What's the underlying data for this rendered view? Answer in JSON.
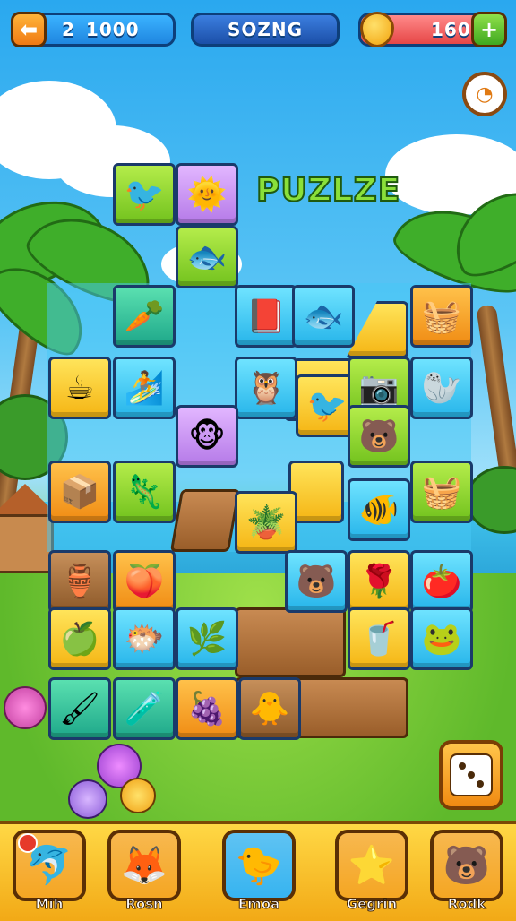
{
  "top_bar": {
    "left_counter": {
      "label": "2",
      "value": "1000"
    },
    "center_title": "SOZNG",
    "right_counter": {
      "value": "160"
    }
  },
  "game_title": "PUZLZE",
  "tiles": [
    {
      "icon": "purple-bird-icon",
      "glyph": "🐦",
      "color": "green"
    },
    {
      "icon": "sun-face-icon",
      "glyph": "🌞",
      "color": "purple"
    },
    {
      "icon": "fish-icon",
      "glyph": "🐟",
      "color": "green"
    },
    {
      "icon": "carrot-icon",
      "glyph": "🥕",
      "color": "teal"
    },
    {
      "icon": "red-book-icon",
      "glyph": "📕",
      "color": "blue"
    },
    {
      "icon": "blue-fish-icon",
      "glyph": "🐟",
      "color": "blue"
    },
    {
      "icon": "basket-icon",
      "glyph": "🧺",
      "color": "orange"
    },
    {
      "icon": "cup-icon",
      "glyph": "☕",
      "color": "yellow"
    },
    {
      "icon": "surfboard-icon",
      "glyph": "🏄",
      "color": "blue"
    },
    {
      "icon": "owl-icon",
      "glyph": "🦉",
      "color": "blue"
    },
    {
      "icon": "blue-bird-icon",
      "glyph": "🐦",
      "color": "yellow"
    },
    {
      "icon": "camera-icon",
      "glyph": "📷",
      "color": "green"
    },
    {
      "icon": "seal-icon",
      "glyph": "🦭",
      "color": "blue"
    },
    {
      "icon": "monkey-icon",
      "glyph": "🐵",
      "color": "purple"
    },
    {
      "icon": "bear-face-icon",
      "glyph": "🐻",
      "color": "green"
    },
    {
      "icon": "purple-box-icon",
      "glyph": "📦",
      "color": "orange"
    },
    {
      "icon": "lizard-icon",
      "glyph": "🦎",
      "color": "green"
    },
    {
      "icon": "plant-pot-icon",
      "glyph": "🪴",
      "color": "yellow"
    },
    {
      "icon": "red-fish-icon",
      "glyph": "🐠",
      "color": "blue"
    },
    {
      "icon": "vegetable-basket-icon",
      "glyph": "🧺",
      "color": "green"
    },
    {
      "icon": "vase-icon",
      "glyph": "🏺",
      "color": "brown"
    },
    {
      "icon": "peach-icon",
      "glyph": "🍑",
      "color": "orange"
    },
    {
      "icon": "blue-bear-icon",
      "glyph": "🐻",
      "color": "blue"
    },
    {
      "icon": "rose-icon",
      "glyph": "🌹",
      "color": "yellow"
    },
    {
      "icon": "tomato-icon",
      "glyph": "🍅",
      "color": "blue"
    },
    {
      "icon": "apple-icon",
      "glyph": "🍏",
      "color": "yellow"
    },
    {
      "icon": "goldfish-icon",
      "glyph": "🐡",
      "color": "blue"
    },
    {
      "icon": "leaf-icon",
      "glyph": "🌿",
      "color": "blue"
    },
    {
      "icon": "drink-icon",
      "glyph": "🥤",
      "color": "yellow"
    },
    {
      "icon": "frog-icon",
      "glyph": "🐸",
      "color": "blue"
    },
    {
      "icon": "brush-icon",
      "glyph": "🖌",
      "color": "teal"
    },
    {
      "icon": "paint-tube-icon",
      "glyph": "🧪",
      "color": "teal"
    },
    {
      "icon": "berries-icon",
      "glyph": "🍇",
      "color": "orange"
    },
    {
      "icon": "chick-icon",
      "glyph": "🐥",
      "color": "brown"
    }
  ],
  "power_ups": [
    {
      "label": "Mih",
      "glyph": "🐬",
      "icon": "dolphin-icon",
      "color": "#f5a623"
    },
    {
      "label": "Rosn",
      "glyph": "🦊",
      "icon": "fox-icon",
      "color": "#f5a623"
    },
    {
      "label": "Emoa",
      "glyph": "🐤",
      "icon": "chick-icon",
      "color": "#37b4f0"
    },
    {
      "label": "Gegrin",
      "glyph": "⭐",
      "icon": "star-creature-icon",
      "color": "#f5a623"
    },
    {
      "label": "Rodk",
      "glyph": "🐻",
      "icon": "bear-icon",
      "color": "#f5a623"
    }
  ],
  "colors": {
    "accent": "#f5b514",
    "blue": "#27b5ea",
    "outline": "#1a3a6a"
  }
}
